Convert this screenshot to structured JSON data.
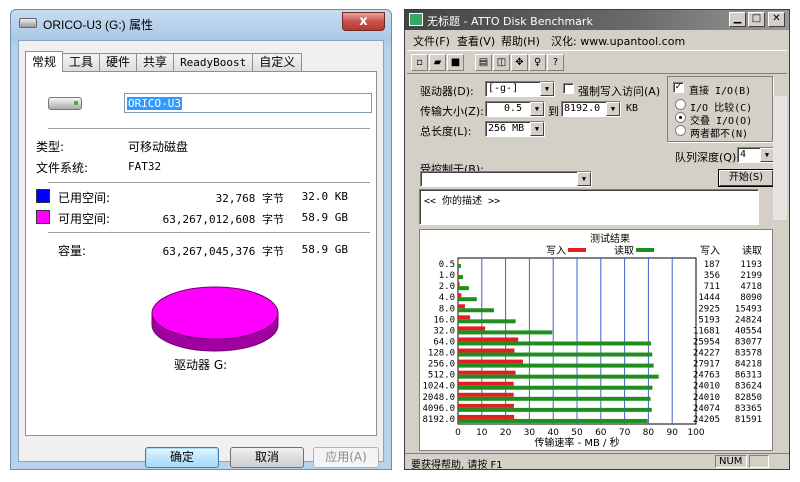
{
  "props": {
    "title": "ORICO-U3 (G:) 属性",
    "close_glyph": "x",
    "tabs": [
      "常规",
      "工具",
      "硬件",
      "共享",
      "ReadyBoost",
      "自定义"
    ],
    "volume_label": "ORICO-U3",
    "type_label": "类型:",
    "type_value": "可移动磁盘",
    "fs_label": "文件系统:",
    "fs_value": "FAT32",
    "used_label": "已用空间:",
    "used_bytes": "32,768 字节",
    "used_size": "32.0 KB",
    "free_label": "可用空间:",
    "free_bytes": "63,267,012,608 字节",
    "free_size": "58.9 GB",
    "capacity_label": "容量:",
    "capacity_bytes": "63,267,045,376 字节",
    "capacity_size": "58.9 GB",
    "drive_caption": "驱动器 G:",
    "used_color": "#0000ff",
    "free_color": "#ff00ff",
    "btn_ok": "确定",
    "btn_cancel": "取消",
    "btn_apply": "应用(A)"
  },
  "atto": {
    "title": "无标题 - ATTO Disk Benchmark",
    "menu": [
      "文件(F)",
      "查看(V)",
      "帮助(H)",
      "汉化: www.upantool.com"
    ],
    "drive_label": "驱动器(D):",
    "drive_value": "[-g-]",
    "force_write_label": "强制写入访问(A)",
    "direct_io_label": "直接 I/O(B)",
    "direct_io_check": "✓",
    "transfer_label": "传输大小(Z):",
    "transfer_from": "0.5",
    "transfer_to_label": "到",
    "transfer_to": "8192.0",
    "transfer_unit": "KB",
    "total_label": "总长度(L):",
    "total_value": "256 MB",
    "io_compare": "I/O 比较(C)",
    "io_overlap": "交叠 I/O(O)",
    "io_neither": "两者都不(N)",
    "queue_label": "队列深度(Q):",
    "queue_value": "4",
    "controlled_label": "受控制于(B):",
    "start_button": "开始(S)",
    "description": "<<  你的描述  >>",
    "status_help": "要获得帮助, 请按 F1",
    "status_num": "NUM"
  },
  "chart_data": {
    "type": "bar",
    "orientation": "horizontal",
    "title": "测试结果",
    "xlabel": "传输速率 - MB / 秒",
    "xlim": [
      0,
      100
    ],
    "xticks": [
      0,
      10,
      20,
      30,
      40,
      50,
      60,
      70,
      80,
      90,
      100
    ],
    "categories": [
      "0.5",
      "1.0",
      "2.0",
      "4.0",
      "8.0",
      "16.0",
      "32.0",
      "64.0",
      "128.0",
      "256.0",
      "512.0",
      "1024.0",
      "2048.0",
      "4096.0",
      "8192.0"
    ],
    "series": [
      {
        "name": "写入",
        "color": "#e02020",
        "values": [
          0.2,
          0.3,
          0.7,
          1.4,
          2.9,
          5.1,
          11.4,
          25.3,
          23.7,
          27.3,
          24.2,
          23.4,
          23.4,
          23.5,
          23.6
        ]
      },
      {
        "name": "读取",
        "color": "#1e8f1e",
        "values": [
          1.2,
          2.1,
          4.6,
          7.9,
          15.1,
          24.2,
          39.6,
          81.1,
          81.6,
          82.2,
          84.3,
          81.7,
          80.9,
          81.4,
          79.7
        ]
      }
    ],
    "table_headers": [
      "写入",
      "读取"
    ],
    "table_write": [
      "187",
      "356",
      "711",
      "1444",
      "2925",
      "5193",
      "11681",
      "25954",
      "24227",
      "27917",
      "24763",
      "24010",
      "24010",
      "24074",
      "24205"
    ],
    "table_read": [
      "1193",
      "2199",
      "4718",
      "8090",
      "15493",
      "24824",
      "40554",
      "83077",
      "83578",
      "84218",
      "86313",
      "83624",
      "82850",
      "83365",
      "81591"
    ]
  }
}
